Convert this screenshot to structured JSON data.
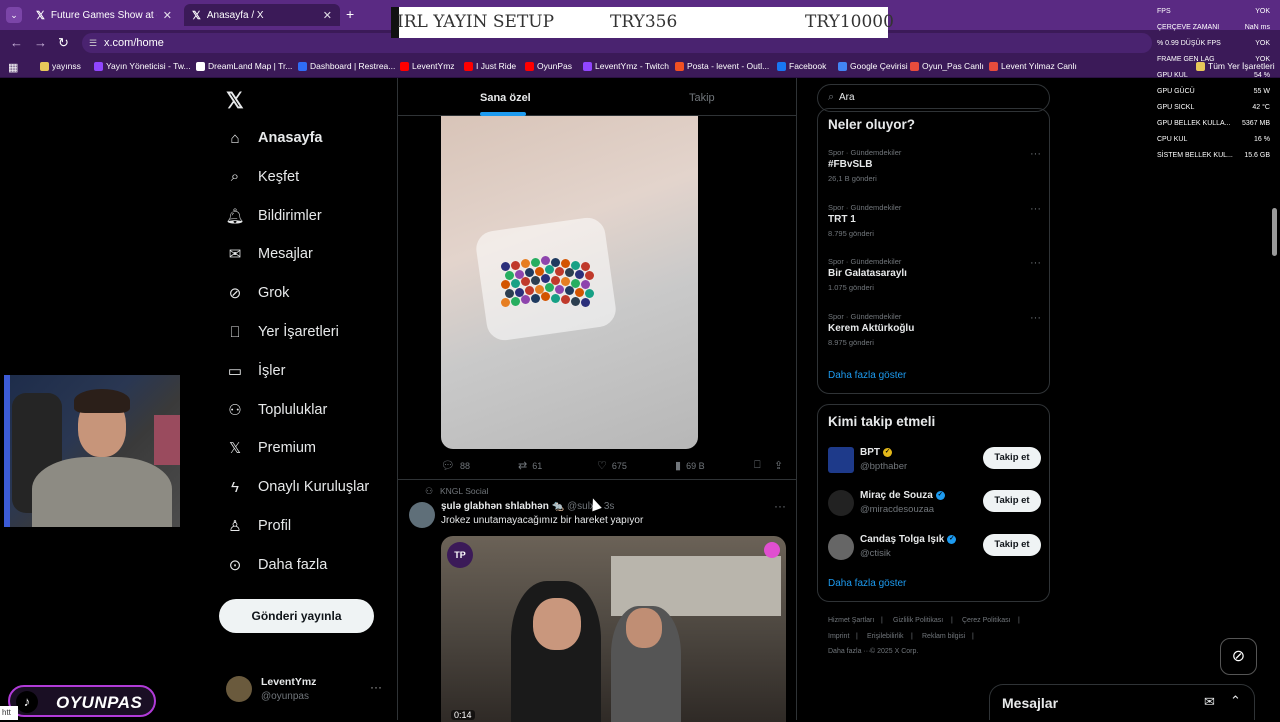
{
  "browser": {
    "tabs": [
      {
        "title": "Future Games Show at gamesc",
        "active": false
      },
      {
        "title": "Anasayfa / X",
        "active": true
      }
    ],
    "url": "x.com/home",
    "bookmarks": [
      {
        "label": "yayınss",
        "color": "#e8c85a"
      },
      {
        "label": "Yayın Yöneticisi - Tw...",
        "color": "#9146ff"
      },
      {
        "label": "DreamLand Map | Tr...",
        "color": "#ffffff"
      },
      {
        "label": "Dashboard | Restrea...",
        "color": "#2f6df6"
      },
      {
        "label": "LeventYmz",
        "color": "#ff0000"
      },
      {
        "label": "I Just Ride",
        "color": "#ff0000"
      },
      {
        "label": "OyunPas",
        "color": "#ff0000"
      },
      {
        "label": "LeventYmz - Twitch",
        "color": "#9146ff"
      },
      {
        "label": "Posta - levent - Outl...",
        "color": "#f25022"
      },
      {
        "label": "Facebook",
        "color": "#1877f2"
      },
      {
        "label": "Google Çevirisi",
        "color": "#4285f4"
      },
      {
        "label": "Oyun_Pas Canlı",
        "color": "#e74c3c"
      },
      {
        "label": "Levent Yılmaz Canlı",
        "color": "#e74c3c"
      },
      {
        "label": "Tüm Yer İşaretleri",
        "color": "#e8c85a"
      }
    ]
  },
  "banner": {
    "title": "IRL YAYIN SETUP",
    "current": "TRY356",
    "goal": "TRY10000"
  },
  "stats": [
    {
      "k": "FPS",
      "v": "YOK"
    },
    {
      "k": "ÇERÇEVE ZAMANI",
      "v": "NaN ms"
    },
    {
      "k": "% 0.99 DÜŞÜK FPS",
      "v": "YOK"
    },
    {
      "k": "FRAME GEN LAG",
      "v": "YOK"
    },
    {
      "k": "GPU KUL",
      "v": "54 %"
    },
    {
      "k": "GPU GÜCÜ",
      "v": "55 W"
    },
    {
      "k": "GPU SICKL",
      "v": "42 °C"
    },
    {
      "k": "GPU BELLEK KULLA...",
      "v": "5367 MB"
    },
    {
      "k": "CPU KUL",
      "v": "16 %"
    },
    {
      "k": "SİSTEM BELLEK KUL...",
      "v": "15.6 GB"
    }
  ],
  "nav": [
    {
      "label": "Anasayfa",
      "icon": "home-icon",
      "glyph": "⌂"
    },
    {
      "label": "Keşfet",
      "icon": "search-icon",
      "glyph": "⌕"
    },
    {
      "label": "Bildirimler",
      "icon": "bell-icon",
      "glyph": "🔔︎"
    },
    {
      "label": "Mesajlar",
      "icon": "mail-icon",
      "glyph": "✉"
    },
    {
      "label": "Grok",
      "icon": "grok-icon",
      "glyph": "⊘"
    },
    {
      "label": "Yer İşaretleri",
      "icon": "bookmark-icon",
      "glyph": "⎕"
    },
    {
      "label": "İşler",
      "icon": "briefcase-icon",
      "glyph": "▭"
    },
    {
      "label": "Topluluklar",
      "icon": "people-icon",
      "glyph": "⚇"
    },
    {
      "label": "Premium",
      "icon": "x-premium-icon",
      "glyph": "𝕏"
    },
    {
      "label": "Onaylı Kuruluşlar",
      "icon": "lightning-icon",
      "glyph": "ϟ"
    },
    {
      "label": "Profil",
      "icon": "person-icon",
      "glyph": "♙"
    },
    {
      "label": "Daha fazla",
      "icon": "more-circle-icon",
      "glyph": "⊙"
    }
  ],
  "post_button": "Gönderi yayınla",
  "profile": {
    "name": "LeventYmz",
    "handle": "@oyunpas"
  },
  "brand": {
    "name": "OYUNPAS"
  },
  "status_tip": "htt",
  "feed": {
    "tab_for_you": "Sana özel",
    "tab_following": "Takip",
    "tweet1_actions": {
      "replies": "88",
      "reposts": "61",
      "likes": "675",
      "views": "69 B"
    },
    "tweet2": {
      "social_context": "KNGL Social",
      "name": "şulə glabhən shlabhən 🐀",
      "handle": "@sulx · 3s",
      "text": "Jrokez unutamayacağımız bir hareket yapıyor",
      "duration": "0:14",
      "badge": "TP"
    }
  },
  "search": {
    "placeholder": "Ara"
  },
  "trends": {
    "title": "Neler oluyor?",
    "items": [
      {
        "category": "Spor · Gündemdekiler",
        "title": "#FBvSLB",
        "count": "26,1 B gönderi"
      },
      {
        "category": "Spor · Gündemdekiler",
        "title": "TRT 1",
        "count": "8.795 gönderi"
      },
      {
        "category": "Spor · Gündemdekiler",
        "title": "Bir Galatasaraylı",
        "count": "1.075 gönderi"
      },
      {
        "category": "Spor · Gündemdekiler",
        "title": "Kerem Aktürkoğlu",
        "count": "8.975 gönderi"
      }
    ],
    "show_more": "Daha fazla göster"
  },
  "who_to_follow": {
    "title": "Kimi takip etmeli",
    "items": [
      {
        "name": "BPT",
        "handle": "@bpthaber",
        "badge": "gold",
        "button": "Takip et"
      },
      {
        "name": "Miraç de Souza",
        "handle": "@miracdesouzaa",
        "badge": "blue",
        "button": "Takip et"
      },
      {
        "name": "Candaş Tolga Işık",
        "handle": "@ctisik",
        "badge": "blue",
        "button": "Takip et"
      }
    ],
    "show_more": "Daha fazla göster"
  },
  "footer": [
    "Hizmet Şartları",
    "|",
    "Gizlilik Politikası",
    "|",
    "Çerez Politikası",
    "|",
    "Imprint",
    "|",
    "Erişilebilirlik",
    "|",
    "Reklam bilgisi",
    "|",
    "Daha fazla ···",
    "© 2025 X Corp."
  ],
  "messages_dock": {
    "title": "Mesajlar"
  },
  "colors": {
    "accent": "#1d9bf0",
    "chrome": "#5a2a83",
    "verified_gold": "#e2b719",
    "verified_blue": "#1d9bf0"
  }
}
